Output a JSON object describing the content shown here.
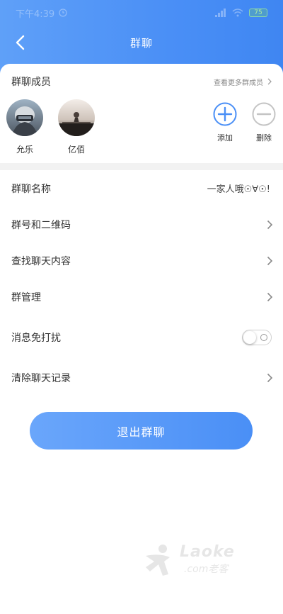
{
  "status_bar": {
    "time": "下午4:39",
    "battery": "75"
  },
  "nav": {
    "title": "群聊"
  },
  "members": {
    "title": "群聊成员",
    "more_label": "查看更多群成员",
    "list": [
      {
        "name": "允乐"
      },
      {
        "name": "亿佰"
      }
    ],
    "add_label": "添加",
    "delete_label": "删除"
  },
  "settings": {
    "group_name_label": "群聊名称",
    "group_name_value": "一家人哦☉∀☉!",
    "qr_label": "群号和二维码",
    "search_label": "查找聊天内容",
    "manage_label": "群管理",
    "mute_label": "消息免打扰",
    "mute_on": false,
    "clear_label": "清除聊天记录"
  },
  "exit_button": "退出群聊",
  "watermark": {
    "text": "Laoke",
    "sub": ".com老客"
  },
  "colors": {
    "accent": "#4a8ff6",
    "gray_icon": "#c4c4c4"
  }
}
